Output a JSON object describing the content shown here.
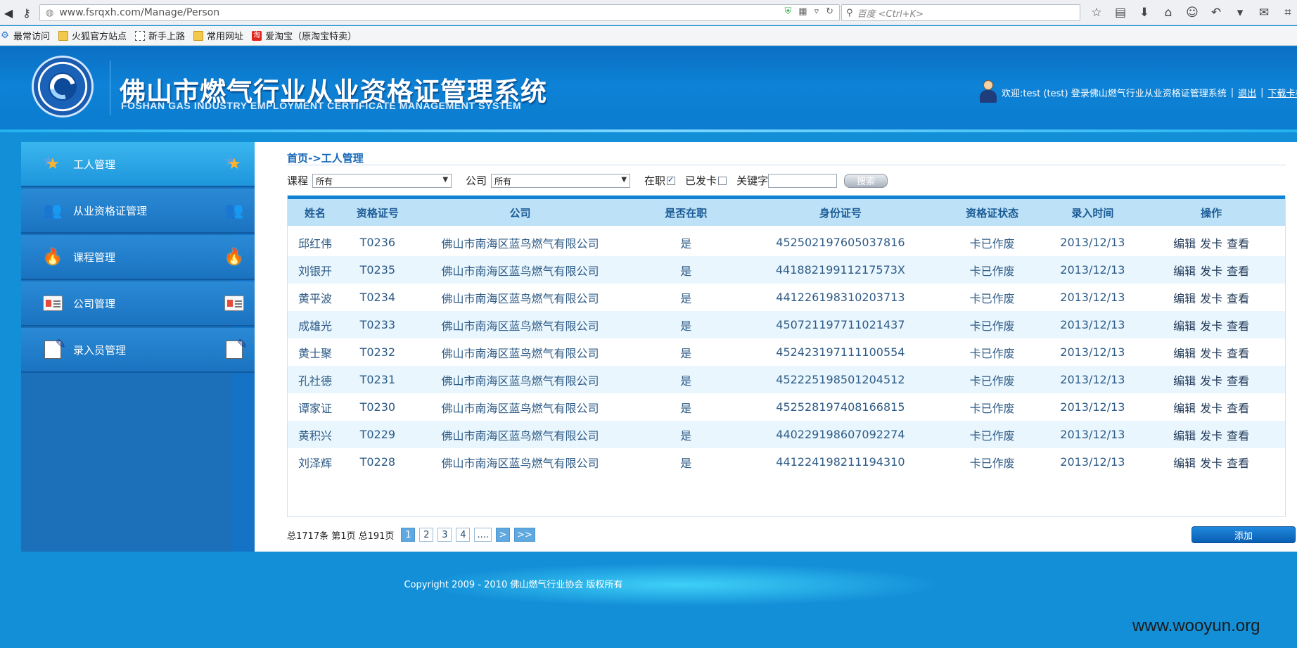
{
  "browser": {
    "url_host": "www.fsrqxh.com",
    "url_path": "/Manage/Person",
    "search_placeholder": "百度 <Ctrl+K>",
    "bookmarks": [
      {
        "label": "最常访问",
        "icon": "gear-icon"
      },
      {
        "label": "火狐官方站点",
        "icon": "folder-icon"
      },
      {
        "label": "新手上路",
        "icon": "page-icon"
      },
      {
        "label": "常用网址",
        "icon": "folder-icon"
      },
      {
        "label": "爱淘宝（原淘宝特卖）",
        "icon": "taobao-icon"
      }
    ]
  },
  "header": {
    "title": "佛山市燃气行业从业资格证管理系统",
    "subtitle": "FOSHAN GAS INDUSTRY EMPLOYMENT CERTIFICATE MANAGEMENT SYSTEM",
    "welcome": "欢迎:test (test) 登录佛山燃气行业从业资格证管理系统",
    "logout": "退出",
    "download": "下载卡机驱"
  },
  "sidebar": {
    "items": [
      {
        "label": "工人管理",
        "icon": "star-icon",
        "active": true
      },
      {
        "label": "从业资格证管理",
        "icon": "people-icon",
        "active": false
      },
      {
        "label": "课程管理",
        "icon": "fire-icon",
        "active": false
      },
      {
        "label": "公司管理",
        "icon": "id-card-icon",
        "active": false
      },
      {
        "label": "录入员管理",
        "icon": "notepad-icon",
        "active": false
      }
    ]
  },
  "main": {
    "breadcrumb": "首页->工人管理",
    "filters": {
      "course_label": "课程",
      "course_value": "所有",
      "company_label": "公司",
      "company_value": "所有",
      "employed_label": "在职",
      "employed_checked": true,
      "card_issued_label": "已发卡",
      "card_issued_checked": false,
      "keyword_label": "关键字",
      "keyword_value": "",
      "search_button": "搜索"
    },
    "table": {
      "columns": [
        "姓名",
        "资格证号",
        "公司",
        "是否在职",
        "身份证号",
        "资格证状态",
        "录入时间",
        "操作"
      ],
      "rows": [
        {
          "name": "邱红伟",
          "cert": "T0236",
          "company": "佛山市南海区蓝鸟燃气有限公司",
          "employed": "是",
          "id": "452502197605037816",
          "status": "卡已作废",
          "date": "2013/12/13"
        },
        {
          "name": "刘银开",
          "cert": "T0235",
          "company": "佛山市南海区蓝鸟燃气有限公司",
          "employed": "是",
          "id": "44188219911217573X",
          "status": "卡已作废",
          "date": "2013/12/13"
        },
        {
          "name": "黄平波",
          "cert": "T0234",
          "company": "佛山市南海区蓝鸟燃气有限公司",
          "employed": "是",
          "id": "441226198310203713",
          "status": "卡已作废",
          "date": "2013/12/13"
        },
        {
          "name": "成雄光",
          "cert": "T0233",
          "company": "佛山市南海区蓝鸟燃气有限公司",
          "employed": "是",
          "id": "450721197711021437",
          "status": "卡已作废",
          "date": "2013/12/13"
        },
        {
          "name": "黄士聚",
          "cert": "T0232",
          "company": "佛山市南海区蓝鸟燃气有限公司",
          "employed": "是",
          "id": "452423197111100554",
          "status": "卡已作废",
          "date": "2013/12/13"
        },
        {
          "name": "孔社德",
          "cert": "T0231",
          "company": "佛山市南海区蓝鸟燃气有限公司",
          "employed": "是",
          "id": "452225198501204512",
          "status": "卡已作废",
          "date": "2013/12/13"
        },
        {
          "name": "谭家证",
          "cert": "T0230",
          "company": "佛山市南海区蓝鸟燃气有限公司",
          "employed": "是",
          "id": "452528197408166815",
          "status": "卡已作废",
          "date": "2013/12/13"
        },
        {
          "name": "黄积兴",
          "cert": "T0229",
          "company": "佛山市南海区蓝鸟燃气有限公司",
          "employed": "是",
          "id": "440229198607092274",
          "status": "卡已作废",
          "date": "2013/12/13"
        },
        {
          "name": "刘泽辉",
          "cert": "T0228",
          "company": "佛山市南海区蓝鸟燃气有限公司",
          "employed": "是",
          "id": "441224198211194310",
          "status": "卡已作废",
          "date": "2013/12/13"
        }
      ],
      "ops": [
        "编辑",
        "发卡",
        "查看"
      ]
    },
    "pager": {
      "info": "总1717条 第1页 总191页",
      "pages": [
        "1",
        "2",
        "3",
        "4",
        "...."
      ],
      "current": "1",
      "next": ">",
      "last": ">>"
    },
    "add_button": "添加"
  },
  "footer": {
    "copyright": "Copyright 2009 - 2010 佛山燃气行业协会 版权所有"
  },
  "watermark": "www.wooyun.org",
  "colors": {
    "page_bg": "#138fd8",
    "header_bg": "#0d82d6",
    "table_header_bg": "#bde1f6",
    "row_alt_bg": "#e9f6fd",
    "accent": "#1283d4"
  }
}
